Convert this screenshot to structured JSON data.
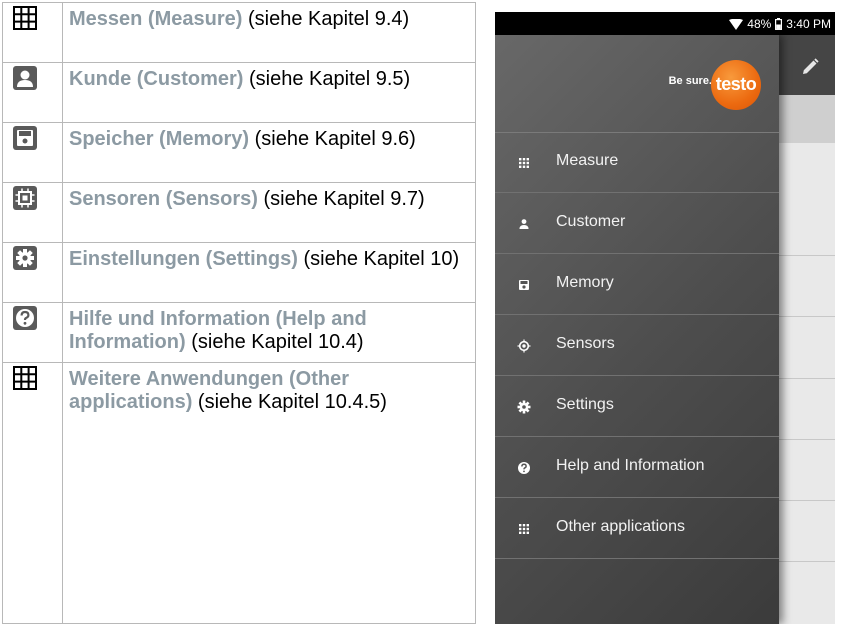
{
  "doc": {
    "rows": [
      {
        "icon": "grid-icon",
        "term": "Messen (Measure)",
        "desc": " (siehe Kapitel 9.4)"
      },
      {
        "icon": "customer-icon",
        "term": "Kunde (Customer)",
        "desc": " (siehe Kapitel 9.5)"
      },
      {
        "icon": "memory-icon",
        "term": "Speicher (Memory)",
        "desc": " (siehe Kapitel 9.6)"
      },
      {
        "icon": "sensor-icon",
        "term": "Sensoren (Sensors)",
        "desc": " (siehe Kapitel 9.7)"
      },
      {
        "icon": "gear-icon",
        "term": "Einstellungen (Settings)",
        "desc": " (siehe Kapitel 10)"
      },
      {
        "icon": "help-icon",
        "term": "Hilfe und Information (Help and Information)",
        "desc": " (siehe Kapitel 10.4)"
      },
      {
        "icon": "grid-icon",
        "term": "Weitere Anwendungen (Other applications)",
        "desc": " (siehe Kapitel 10.4.5)"
      }
    ]
  },
  "phone": {
    "status": {
      "battery": "48%",
      "time": "3:40 PM"
    },
    "brand": {
      "tagline": "Be sure.",
      "logo": "testo"
    },
    "menu": [
      {
        "icon": "grid-icon",
        "label": "Measure"
      },
      {
        "icon": "customer-icon",
        "label": "Customer"
      },
      {
        "icon": "memory-icon",
        "label": "Memory"
      },
      {
        "icon": "sensor-icon",
        "label": "Sensors"
      },
      {
        "icon": "gear-icon",
        "label": "Settings"
      },
      {
        "icon": "help-icon",
        "label": "Help and Information"
      },
      {
        "icon": "grid-icon",
        "label": "Other applications"
      }
    ],
    "colors": {
      "accent": "#ec6a10",
      "drawer": "#555555",
      "term": "#8c9aa3"
    }
  }
}
